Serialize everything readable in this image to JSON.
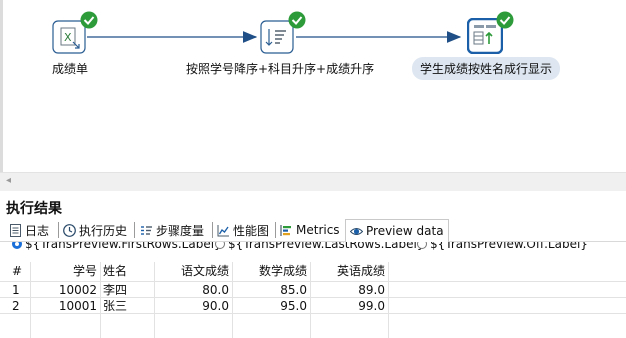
{
  "canvas": {
    "steps": [
      {
        "label": "成绩单",
        "icon": "excel-input-icon",
        "status": "ok"
      },
      {
        "label": "按照学号降序+科目升序+成绩升序",
        "icon": "sort-rows-icon",
        "status": "ok"
      },
      {
        "label": "学生成绩按姓名成行显示",
        "icon": "row-denormaliser-icon",
        "status": "ok"
      }
    ],
    "accent": "#1a5fa8",
    "ok_color": "#2e9b3a"
  },
  "results": {
    "title": "执行结果",
    "tabs": [
      {
        "label": "日志",
        "icon": "log-icon"
      },
      {
        "label": "执行历史",
        "icon": "history-icon"
      },
      {
        "label": "步骤度量",
        "icon": "step-metrics-icon"
      },
      {
        "label": "性能图",
        "icon": "performance-chart-icon"
      },
      {
        "label": "Metrics",
        "icon": "metrics-icon"
      },
      {
        "label": "Preview data",
        "icon": "preview-eye-icon",
        "active": true
      }
    ],
    "radio_options": [
      {
        "label": "${TransPreview.FirstRows.Label}",
        "selected": true
      },
      {
        "label": "${TransPreview.LastRows.Label}",
        "selected": false
      },
      {
        "label": "${TransPreview.Off.Label}",
        "selected": false
      }
    ],
    "columns": [
      "#",
      "学号",
      "姓名",
      "语文成绩",
      "数学成绩",
      "英语成绩"
    ],
    "rows": [
      [
        "1",
        "10002",
        "李四",
        "80.0",
        "85.0",
        "89.0"
      ],
      [
        "2",
        "10001",
        "张三",
        "90.0",
        "95.0",
        "99.0"
      ]
    ]
  }
}
